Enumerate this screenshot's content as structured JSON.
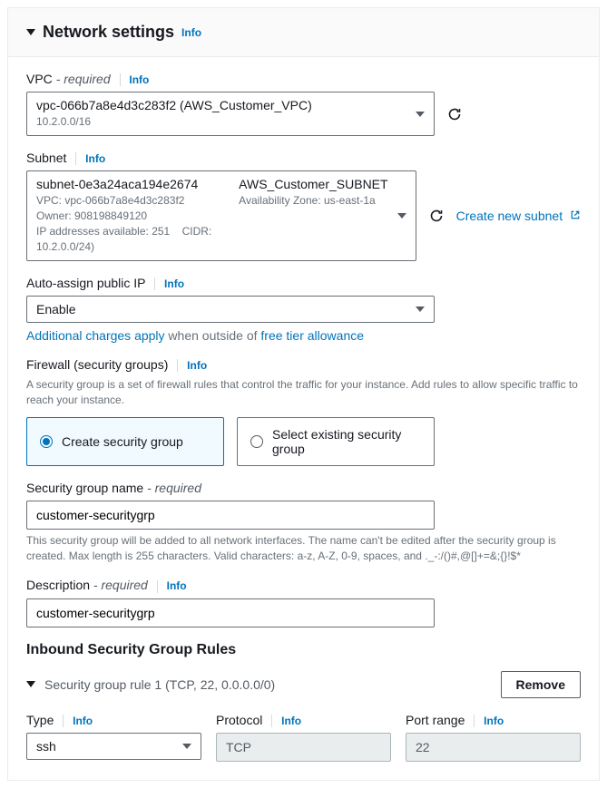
{
  "header": {
    "title": "Network settings",
    "info": "Info"
  },
  "vpc": {
    "label": "VPC",
    "required": "- required",
    "info": "Info",
    "value": "vpc-066b7a8e4d3c283f2 (AWS_Customer_VPC)",
    "cidr": "10.2.0.0/16"
  },
  "subnet": {
    "label": "Subnet",
    "info": "Info",
    "value": "subnet-0e3a24aca194e2674",
    "name": "AWS_Customer_SUBNET",
    "vpc_line": "VPC: vpc-066b7a8e4d3c283f2",
    "owner": "Owner: 908198849120",
    "az": "Availability Zone: us-east-1a",
    "ips": "IP addresses available: 251",
    "cidr": "CIDR: 10.2.0.0/24)",
    "create_link": "Create new subnet"
  },
  "auto_ip": {
    "label": "Auto-assign public IP",
    "info": "Info",
    "value": "Enable",
    "note_link1": "Additional charges apply",
    "note_mid": " when outside of ",
    "note_link2": "free tier allowance"
  },
  "firewall": {
    "label": "Firewall (security groups)",
    "info": "Info",
    "help": "A security group is a set of firewall rules that control the traffic for your instance. Add rules to allow specific traffic to reach your instance.",
    "opt_create": "Create security group",
    "opt_existing": "Select existing security group"
  },
  "sg_name": {
    "label": "Security group name",
    "required": "- required",
    "value": "customer-securitygrp",
    "help": "This security group will be added to all network interfaces. The name can't be edited after the security group is created. Max length is 255 characters. Valid characters: a-z, A-Z, 0-9, spaces, and ._-:/()#,@[]+=&;{}!$*"
  },
  "sg_desc": {
    "label": "Description",
    "required": "- required",
    "info": "Info",
    "value": "customer-securitygrp"
  },
  "inbound": {
    "title": "Inbound Security Group Rules",
    "rule_summary": "Security group rule 1 (TCP, 22, 0.0.0.0/0)",
    "remove": "Remove",
    "type_label": "Type",
    "type_info": "Info",
    "type_value": "ssh",
    "protocol_label": "Protocol",
    "protocol_info": "Info",
    "protocol_value": "TCP",
    "port_label": "Port range",
    "port_info": "Info",
    "port_value": "22"
  }
}
